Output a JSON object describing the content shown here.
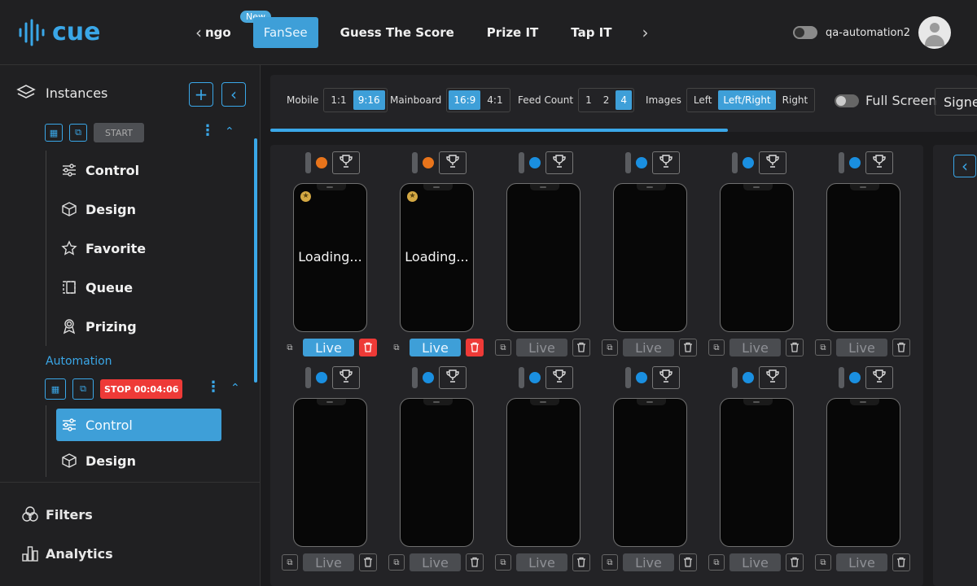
{
  "brand": {
    "name": "cue"
  },
  "header": {
    "tabs": [
      {
        "label": "ngo",
        "badge": "New",
        "active": false
      },
      {
        "label": "FanSee",
        "active": true
      },
      {
        "label": "Guess The Score",
        "active": false
      },
      {
        "label": "Prize IT",
        "active": false
      },
      {
        "label": "Tap IT",
        "active": false
      }
    ],
    "username": "qa-automation2"
  },
  "sidebar": {
    "title": "Instances",
    "instance1": {
      "start_label": "START"
    },
    "menu1": [
      {
        "label": "Control",
        "icon": "sliders-icon"
      },
      {
        "label": "Design",
        "icon": "cube-icon"
      },
      {
        "label": "Favorite",
        "icon": "star-icon"
      },
      {
        "label": "Queue",
        "icon": "queue-icon"
      },
      {
        "label": "Prizing",
        "icon": "award-icon"
      }
    ],
    "automation_label": "Automation",
    "instance2": {
      "stop_label": "STOP 00:04:06"
    },
    "menu2": [
      {
        "label": "Control",
        "icon": "sliders-icon",
        "selected": true
      },
      {
        "label": "Design",
        "icon": "cube-icon"
      }
    ],
    "bottom": [
      {
        "label": "Filters",
        "icon": "filters-icon"
      },
      {
        "label": "Analytics",
        "icon": "analytics-icon"
      }
    ]
  },
  "controls": {
    "mobile": {
      "label": "Mobile",
      "options": [
        "1:1",
        "9:16"
      ],
      "selected": "9:16"
    },
    "mainboard": {
      "label": "Mainboard",
      "options": [
        "16:9",
        "4:1"
      ],
      "selected": "16:9"
    },
    "feed_count": {
      "label": "Feed Count",
      "options": [
        "1",
        "2",
        "4"
      ],
      "selected": "4"
    },
    "images": {
      "label": "Images",
      "options": [
        "Left",
        "Left/Right",
        "Right"
      ],
      "selected": "Left/Right"
    },
    "full_screen": {
      "label": "Full Screen",
      "on": false
    },
    "sign_label": "Signe"
  },
  "feeds": [
    {
      "status_color": "#e8741b",
      "loading": "Loading...",
      "live": true
    },
    {
      "status_color": "#e8741b",
      "loading": "Loading...",
      "live": true
    },
    {
      "status_color": "#1a8fe0",
      "loading": "",
      "live": false
    },
    {
      "status_color": "#1a8fe0",
      "loading": "",
      "live": false
    },
    {
      "status_color": "#1a8fe0",
      "loading": "",
      "live": false
    },
    {
      "status_color": "#1a8fe0",
      "loading": "",
      "live": false
    },
    {
      "status_color": "#1a8fe0",
      "loading": "",
      "live": false
    },
    {
      "status_color": "#1a8fe0",
      "loading": "",
      "live": false
    },
    {
      "status_color": "#1a8fe0",
      "loading": "",
      "live": false
    },
    {
      "status_color": "#1a8fe0",
      "loading": "",
      "live": false
    },
    {
      "status_color": "#1a8fe0",
      "loading": "",
      "live": false
    },
    {
      "status_color": "#1a8fe0",
      "loading": "",
      "live": false
    }
  ],
  "live_label": "Live",
  "colors": {
    "accent": "#3e9fd8",
    "danger": "#ee3a37",
    "pending": "#e8741b",
    "ready": "#1a8fe0"
  }
}
